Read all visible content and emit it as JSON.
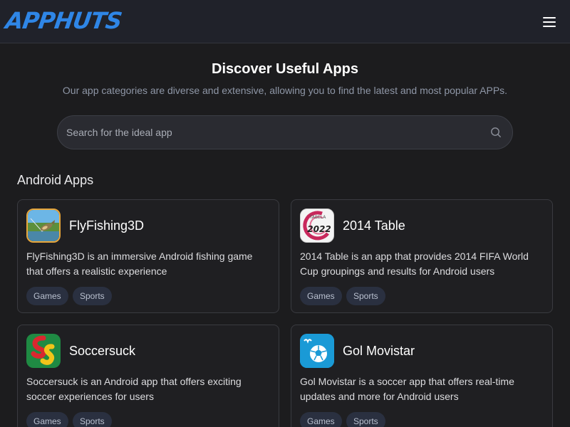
{
  "header": {
    "logo_text": "APPHUTS",
    "menu_icon": "hamburger-menu-icon",
    "brand_color": "#2f86e6"
  },
  "hero": {
    "title": "Discover Useful Apps",
    "subtitle": "Our app categories are diverse and extensive, allowing you to find the latest and most popular APPs."
  },
  "search": {
    "placeholder": "Search for the ideal app",
    "icon": "search-icon"
  },
  "section": {
    "title": "Android Apps"
  },
  "apps": [
    {
      "name": "FlyFishing3D",
      "description": "FlyFishing3D is an immersive Android fishing game that offers a realistic experience",
      "tags": [
        "Games",
        "Sports"
      ],
      "icon": "fly-fishing-app-icon"
    },
    {
      "name": "2014 Table",
      "description": "2014 Table is an app that provides 2014 FIFA World Cup groupings and results for Android users",
      "tags": [
        "Games",
        "Sports"
      ],
      "icon": "table-2022-app-icon",
      "icon_text_top": "TABELA",
      "icon_text_main": "2022"
    },
    {
      "name": "Soccersuck",
      "description": "Soccersuck is an Android app that offers exciting soccer experiences for users",
      "tags": [
        "Games",
        "Sports"
      ],
      "icon": "soccersuck-app-icon"
    },
    {
      "name": "Gol Movistar",
      "description": "Gol Movistar is a soccer app that offers real-time updates and more for Android users",
      "tags": [
        "Games",
        "Sports"
      ],
      "icon": "gol-movistar-app-icon"
    }
  ]
}
